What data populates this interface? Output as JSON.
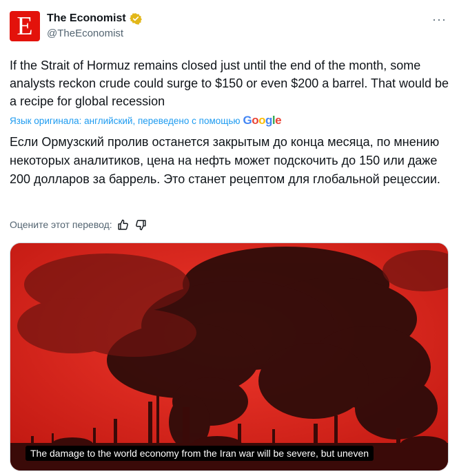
{
  "author": {
    "avatar_letter": "E",
    "name": "The Economist",
    "handle": "@TheEconomist",
    "verified_icon": "verified-badge-icon",
    "brand_color": "#e3120b"
  },
  "more_icon": "more-icon",
  "more_label": "···",
  "tweet": {
    "text_original": "If the Strait of Hormuz remains closed just until the end of the month, some analysts reckon crude could surge to $150 or even $200 a barrel. That would be a recipe for global recession",
    "translation_note": "Язык оригинала: английский, переведено с помощью",
    "translation_provider": "Google",
    "text_translated": "Если Ормузский пролив останется закрытым до конца месяца, по мнению некоторых аналитиков, цена на нефть может подскочить до 150 или даже 200 долларов за баррель. Это станет рецептом для глобальной рецессии."
  },
  "rate_translation": {
    "label": "Оцените этот перевод:",
    "thumbs_up_icon": "thumbs-up-icon",
    "thumbs_down_icon": "thumbs-down-icon"
  },
  "media": {
    "caption": "The damage to the world economy from the Iran war will be severe, but uneven",
    "tint_color": "#d8231d"
  }
}
